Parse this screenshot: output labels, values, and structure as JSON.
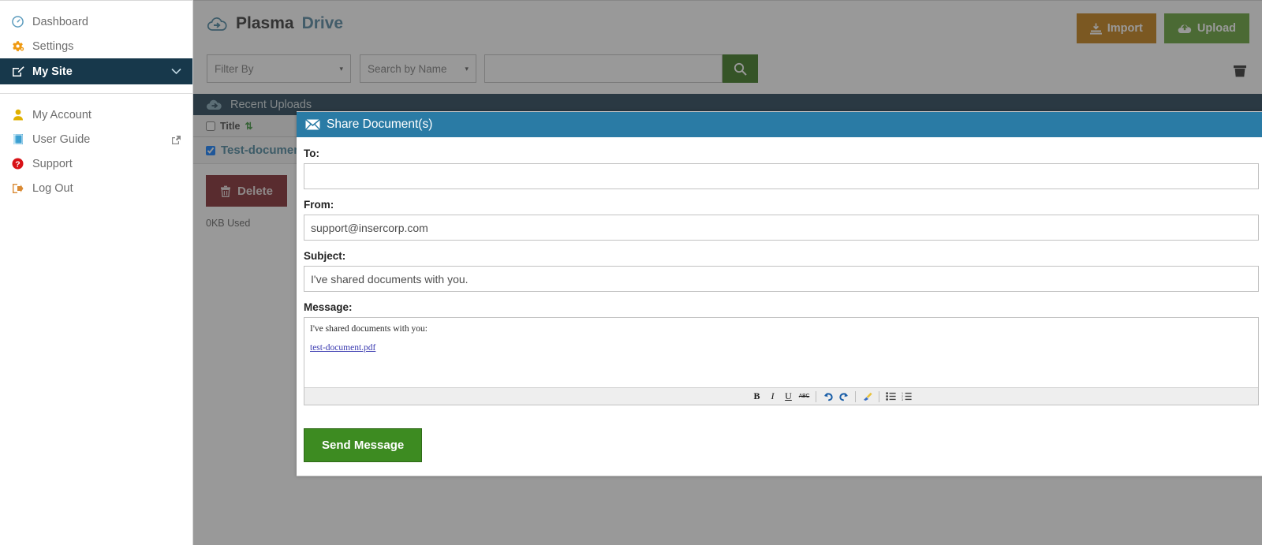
{
  "sidebar": {
    "items": [
      {
        "label": "Dashboard",
        "icon": "dashboard-icon",
        "active": false
      },
      {
        "label": "Settings",
        "icon": "gear-icon",
        "active": false
      },
      {
        "label": "My Site",
        "icon": "edit-icon",
        "active": true,
        "chevron": "⌄"
      }
    ],
    "secondary": [
      {
        "label": "My Account",
        "icon": "user-icon"
      },
      {
        "label": "User Guide",
        "icon": "book-icon",
        "external": "↪"
      },
      {
        "label": "Support",
        "icon": "help-icon"
      },
      {
        "label": "Log Out",
        "icon": "logout-icon"
      }
    ]
  },
  "header": {
    "brand_primary": "Plasma",
    "brand_secondary": "Drive",
    "brand_icon": "cloud-arrow-icon",
    "import_label": "Import",
    "upload_label": "Upload",
    "import_color": "#c07808",
    "upload_color": "#5c9e2c",
    "trash_icon": "trash-icon"
  },
  "filters": {
    "filter_by": "Filter By",
    "search_by": "Search by Name",
    "search_value": "",
    "search_placeholder": "",
    "search_icon": "search-icon",
    "caret": "▾"
  },
  "panel": {
    "title": "Recent Uploads",
    "icon": "cloud-arrow-icon",
    "column_title": "Title",
    "sort_icon": "⇵",
    "rows": [
      {
        "title": "Test-document",
        "checked": true
      }
    ],
    "buttons": [
      {
        "label": "Delete",
        "icon": "trash-icon",
        "color": "#7a1c22"
      },
      {
        "label": "",
        "icon": "",
        "color": "#9a6a06"
      }
    ],
    "usage": "0KB Used"
  },
  "modal": {
    "title": "Share Document(s)",
    "title_icon": "envelope-icon",
    "accent": "#2a7ba5",
    "fields": {
      "to_label": "To:",
      "to_value": "",
      "from_label": "From:",
      "from_value": "support@insercorp.com",
      "subject_label": "Subject:",
      "subject_value": "I've shared documents with you.",
      "message_label": "Message:",
      "message_text": "I've shared documents with you:",
      "message_link": "test-document.pdf"
    },
    "toolbar": [
      {
        "name": "bold-icon",
        "glyph": "B"
      },
      {
        "name": "italic-icon",
        "glyph": "I"
      },
      {
        "name": "underline-icon",
        "glyph": "U"
      },
      {
        "name": "strikethrough-icon",
        "glyph": "ABC"
      },
      {
        "name": "undo-icon",
        "glyph": "↶"
      },
      {
        "name": "redo-icon",
        "glyph": "↷"
      },
      {
        "name": "remove-format-icon",
        "glyph": "✒"
      },
      {
        "name": "bullet-list-icon",
        "glyph": "☰"
      },
      {
        "name": "numbered-list-icon",
        "glyph": "≡"
      }
    ],
    "send_label": "Send Message",
    "send_color": "#3d8b21"
  }
}
